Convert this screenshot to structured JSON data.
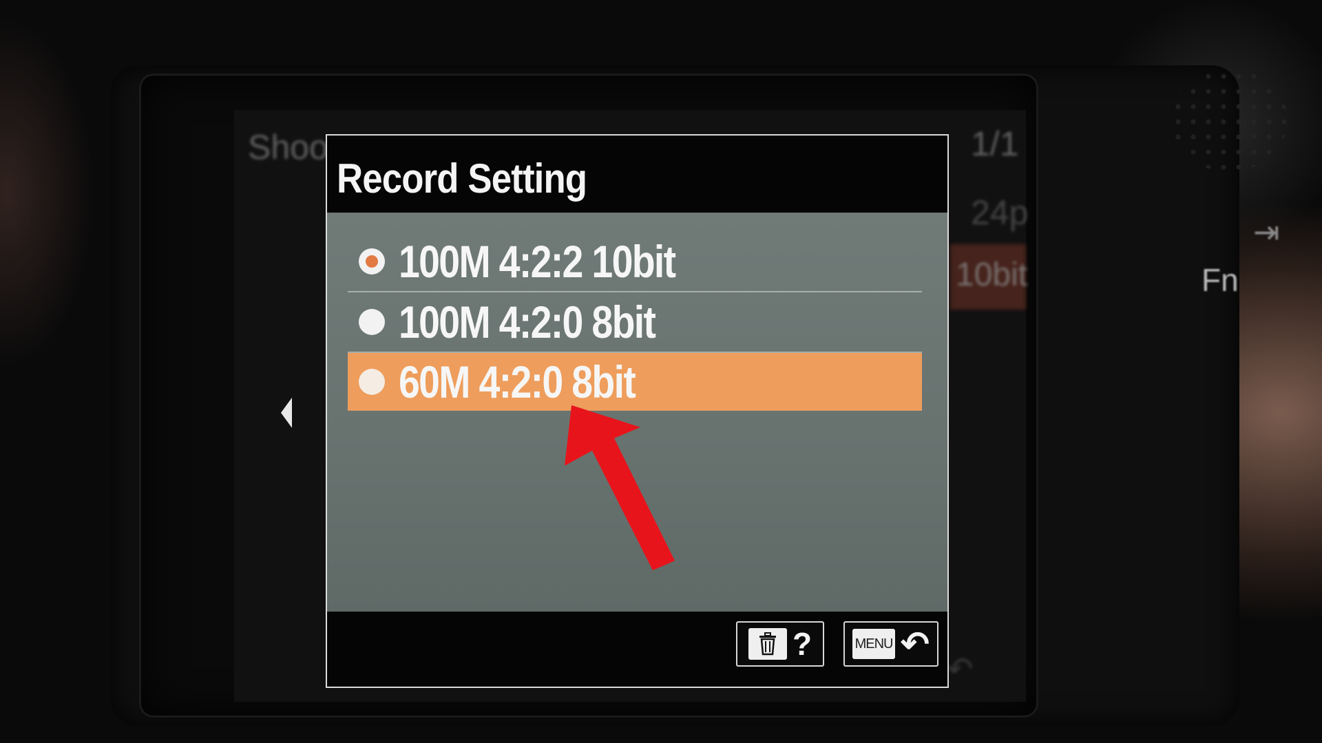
{
  "background_menu": {
    "left_label": "Shoot",
    "page_indicator": "1/1",
    "right_value_1": "24p",
    "right_value_2": "10bit",
    "fn_label": "Fn"
  },
  "dialog": {
    "title": "Record Setting",
    "options": [
      {
        "label": "100M 4:2:2 10bit",
        "checked": true,
        "highlighted": false
      },
      {
        "label": "100M 4:2:0 8bit",
        "checked": false,
        "highlighted": false
      },
      {
        "label": "60M 4:2:0 8bit",
        "checked": false,
        "highlighted": true
      }
    ],
    "footer": {
      "delete_help_mark": "?",
      "menu_label": "MENU",
      "back_mark": "↶"
    }
  },
  "colors": {
    "highlight": "#ee9d5c",
    "radio_dot": "#e27a43",
    "annotation_arrow": "#e8141b"
  },
  "icons": {
    "trash": "trash-icon",
    "back": "return-arrow-icon",
    "annotation": "red-pointer-arrow"
  }
}
